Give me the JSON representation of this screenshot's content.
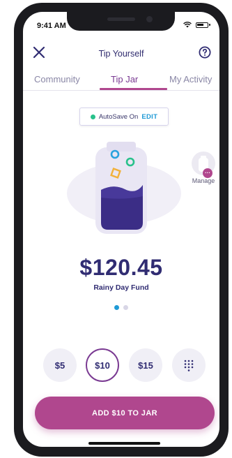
{
  "status": {
    "time": "9:41 AM"
  },
  "header": {
    "title": "Tip Yourself"
  },
  "tabs": [
    {
      "label": "Community"
    },
    {
      "label": "Tip Jar"
    },
    {
      "label": "My Activity"
    }
  ],
  "autosave": {
    "status": "AutoSave On",
    "edit_label": "EDIT"
  },
  "manage": {
    "label": "Manage"
  },
  "jar": {
    "amount": "$120.45",
    "name": "Rainy Day Fund"
  },
  "pager": {
    "total": 2,
    "active": 1
  },
  "amounts": [
    {
      "label": "$5"
    },
    {
      "label": "$10",
      "selected": true
    },
    {
      "label": "$15"
    }
  ],
  "cta": {
    "label": "ADD $10 TO JAR"
  },
  "colors": {
    "accent": "#b0478e",
    "primary_text": "#302c72",
    "link": "#1f9ad6",
    "autosave_dot": "#28c18b"
  }
}
